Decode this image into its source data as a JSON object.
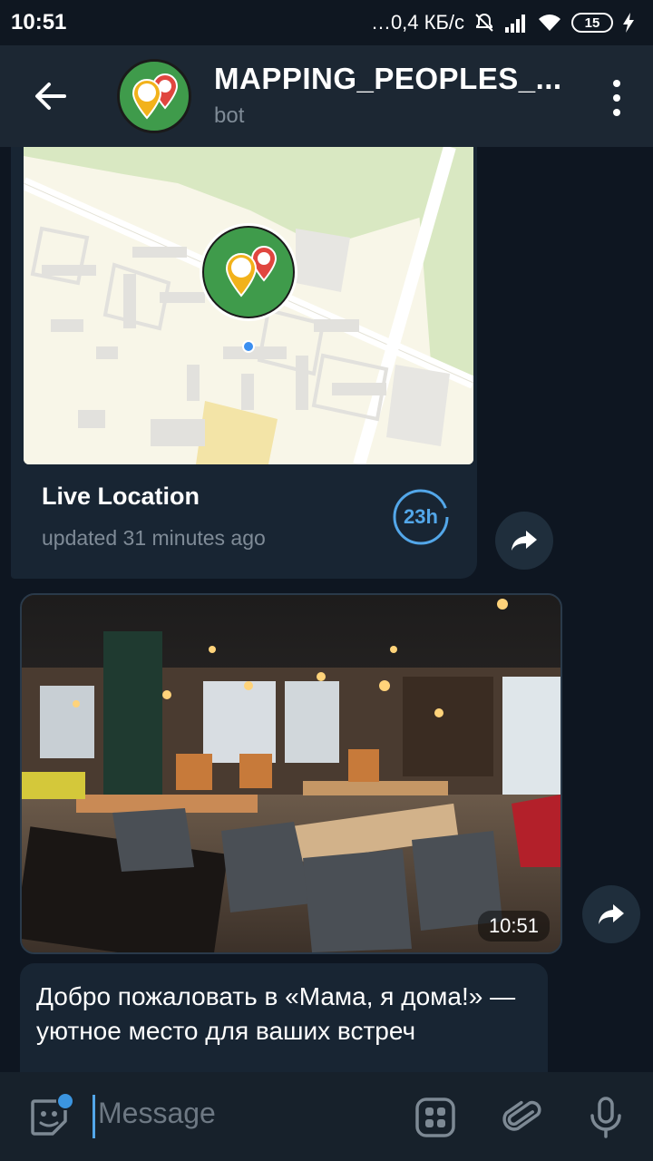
{
  "status_bar": {
    "time": "10:51",
    "network": "…0,4 КБ/с",
    "battery": "15"
  },
  "header": {
    "title": "MAPPING_PEOPLES_...",
    "subtitle": "bot"
  },
  "messages": {
    "live_location": {
      "title": "Live Location",
      "updated": "updated 31 minutes ago",
      "timer": "23h"
    },
    "photo": {
      "time": "10:51"
    },
    "text": {
      "body": "Добро пожаловать в «Мама, я дома!» — уютное место для ваших встреч"
    }
  },
  "input": {
    "placeholder": "Message"
  },
  "colors": {
    "background": "#0e1621",
    "header": "#1c2733",
    "bubble": "#182533",
    "accent": "#53a7e9"
  },
  "icons": {
    "back": "arrow-left-icon",
    "menu": "more-vertical-icon",
    "share": "share-icon",
    "emoji": "sticker-icon",
    "bot_commands": "grid-icon",
    "attach": "paperclip-icon",
    "mic": "microphone-icon"
  }
}
